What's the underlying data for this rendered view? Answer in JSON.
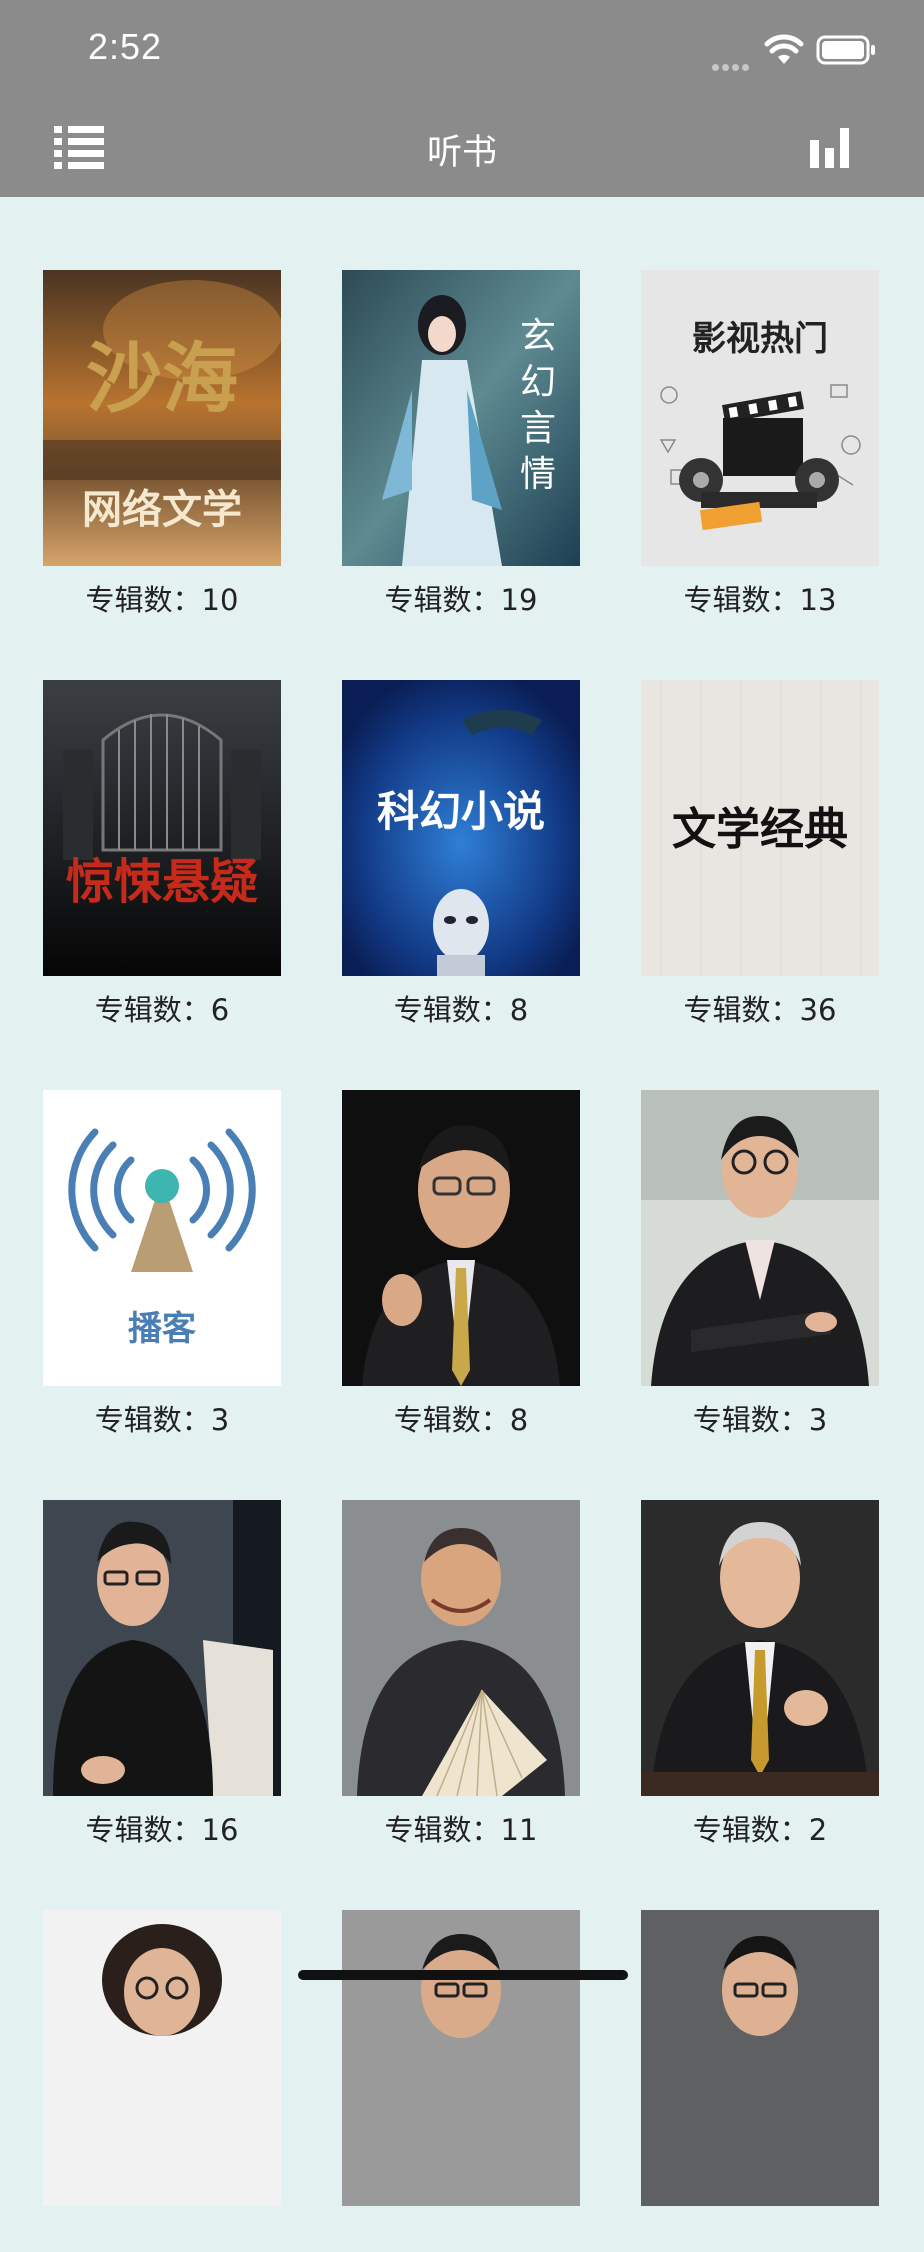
{
  "status_bar": {
    "time": "2:52"
  },
  "nav": {
    "title": "听书"
  },
  "albums": [
    {
      "cover_text": "沙海",
      "cover_subtext": "网络文学",
      "count_label": "专辑数：10"
    },
    {
      "cover_text": "玄幻言情",
      "count_label": "专辑数：19"
    },
    {
      "cover_text": "影视热门",
      "count_label": "专辑数：13"
    },
    {
      "cover_text": "惊悚悬疑",
      "count_label": "专辑数：6"
    },
    {
      "cover_text": "科幻小说",
      "count_label": "专辑数：8"
    },
    {
      "cover_text": "文学经典",
      "count_label": "专辑数：36"
    },
    {
      "cover_text": "播客",
      "count_label": "专辑数：3"
    },
    {
      "count_label": "专辑数：8"
    },
    {
      "count_label": "专辑数：3"
    },
    {
      "count_label": "专辑数：16"
    },
    {
      "count_label": "专辑数：11"
    },
    {
      "count_label": "专辑数：2"
    },
    {
      "count_label": ""
    },
    {
      "count_label": ""
    },
    {
      "count_label": ""
    }
  ],
  "colors": {
    "nav_bg": "#8b8b8b",
    "page_bg": "#e4f1f1",
    "text": "#222222",
    "horror_red": "#c62a1a",
    "podcast_blue": "#4a7fb5"
  },
  "icons": {
    "menu": "menu-icon",
    "stats": "bar-chart-icon",
    "wifi": "wifi-icon",
    "battery": "battery-icon"
  }
}
